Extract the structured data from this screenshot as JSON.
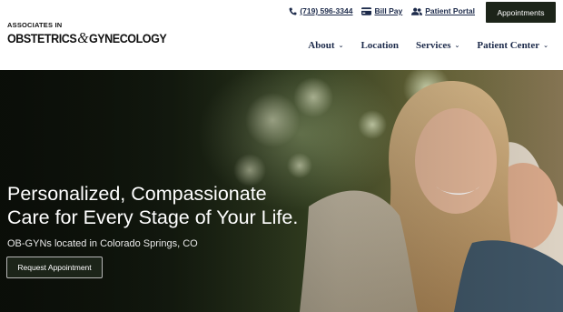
{
  "header": {
    "logo": {
      "line1": "ASSOCIATES IN",
      "obstetrics": "OBSTETRICS",
      "ampersand": "&",
      "gynecology": "GYNECOLOGY"
    },
    "top_links": {
      "phone": "(719) 596-3344",
      "bill_pay": "Bill Pay",
      "patient_portal": "Patient Portal"
    },
    "appointments_label": "Appointments",
    "nav": [
      {
        "label": "About",
        "has_dropdown": true
      },
      {
        "label": "Location",
        "has_dropdown": false
      },
      {
        "label": "Services",
        "has_dropdown": true
      },
      {
        "label": "Patient Center",
        "has_dropdown": true
      }
    ]
  },
  "hero": {
    "headline_line1": "Personalized, Compassionate",
    "headline_line2": "Care for Every Stage of Your Life.",
    "subheadline": "OB-GYNs located in Colorado Springs, CO",
    "cta_label": "Request Appointment"
  },
  "icons": {
    "phone": "phone-icon",
    "bill_pay": "credit-card-icon",
    "patient_portal": "users-icon",
    "dropdown": "chevron-down-icon"
  },
  "colors": {
    "brand_navy": "#1c2a4a",
    "button_dark": "#1c2419",
    "hero_text": "#ffffff"
  }
}
